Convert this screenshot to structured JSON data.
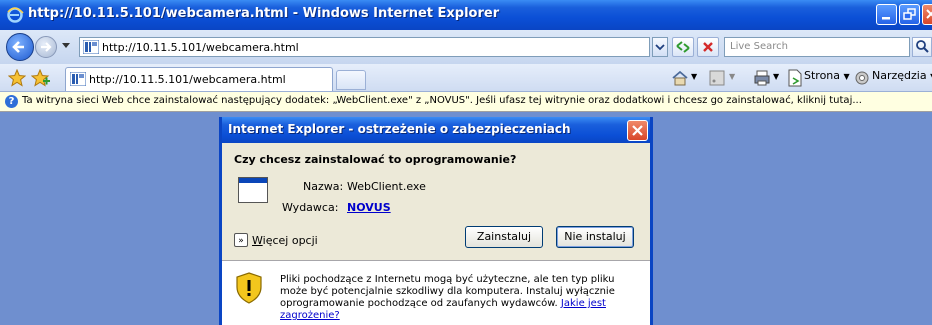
{
  "window": {
    "title": "http://10.11.5.101/webcamera.html - Windows Internet Explorer"
  },
  "address_bar": {
    "url": "http://10.11.5.101/webcamera.html"
  },
  "search": {
    "placeholder": "Live Search"
  },
  "tab": {
    "title": "http://10.11.5.101/webcamera.html"
  },
  "commands": {
    "page": "Strona",
    "tools": "Narzędzia"
  },
  "infobar": {
    "message": "Ta witryna sieci Web chce zainstalować następujący dodatek: „WebClient.exe\" z „NOVUS\". Jeśli ufasz tej witrynie oraz dodatkowi i chcesz go zainstalować, kliknij tutaj..."
  },
  "dialog": {
    "title": "Internet Explorer - ostrzeżenie o zabezpieczeniach",
    "question": "Czy chcesz zainstalować to oprogramowanie?",
    "name_label": "Nazwa:",
    "name_value": "WebClient.exe",
    "publisher_label": "Wydawca:",
    "publisher_value": "NOVUS",
    "more_options_first": "W",
    "more_options_rest": "ięcej opcji",
    "install_button": "Zainstaluj",
    "dont_install_button": "Nie instaluj",
    "warning_text": "Pliki pochodzące z Internetu mogą być użyteczne, ale ten typ pliku może być potencjalnie szkodliwy dla komputera. Instaluj wyłącznie oprogramowanie pochodzące od zaufanych wydawców.",
    "warning_link": "Jakie jest zagrożenie?"
  },
  "colors": {
    "titlebar": "#0a45c4",
    "infobar": "#ffffe1",
    "dialog_face": "#ece9d8",
    "link": "#0000cc"
  }
}
